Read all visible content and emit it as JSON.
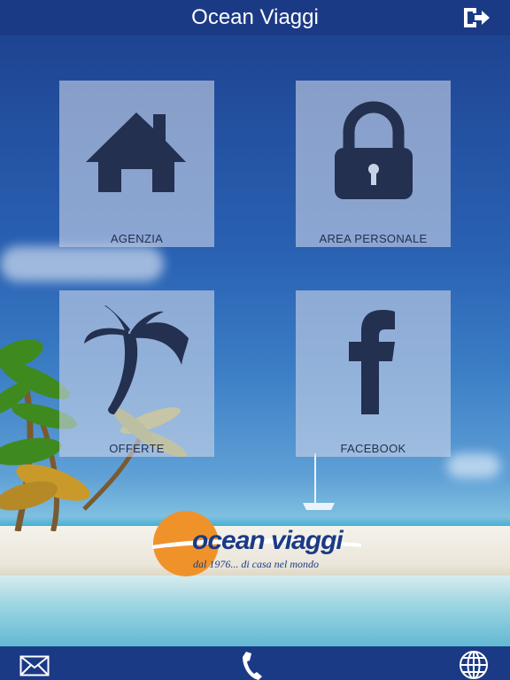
{
  "header": {
    "title": "Ocean Viaggi"
  },
  "tiles": [
    {
      "label": "AGENZIA"
    },
    {
      "label": "AREA PERSONALE"
    },
    {
      "label": "OFFERTE"
    },
    {
      "label": "FACEBOOK"
    }
  ],
  "logo": {
    "brand": "ocean viaggi",
    "tagline": "dal 1976... di casa nel mondo"
  },
  "colors": {
    "bar": "#1b3a86",
    "tile_icon": "#24304f",
    "logo_orange": "#f0922a"
  },
  "bottom": {
    "icons": [
      "mail-icon",
      "phone-icon",
      "globe-icon"
    ]
  }
}
